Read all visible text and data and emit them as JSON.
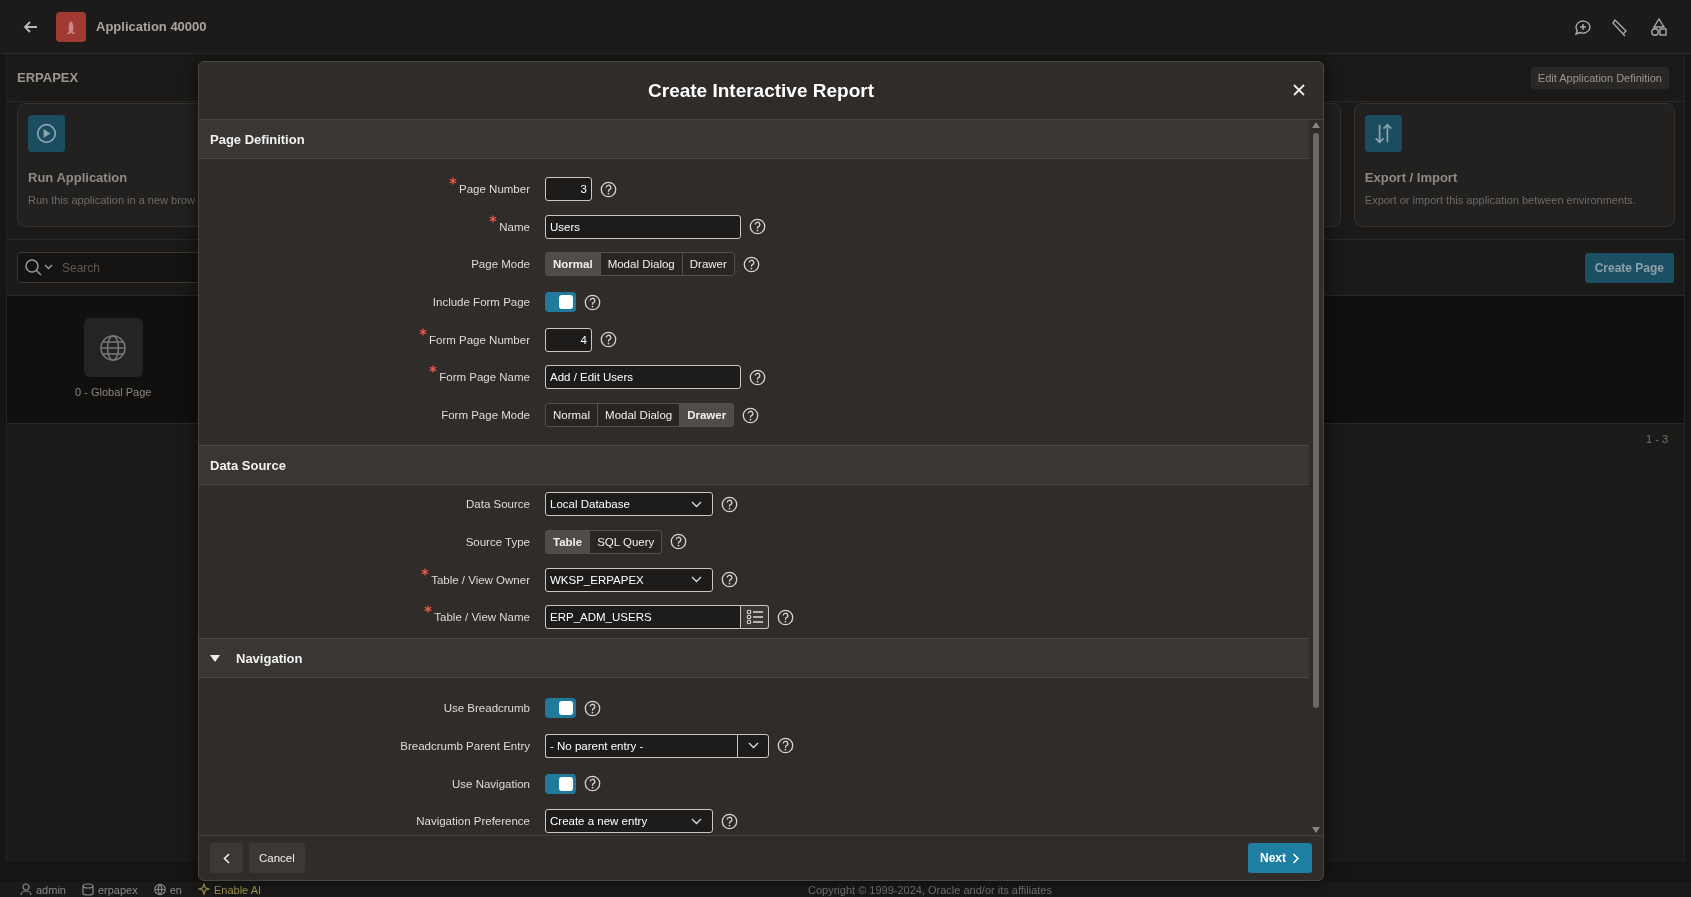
{
  "topbar": {
    "app_title": "Application 40000"
  },
  "workspace": {
    "title": "ERPAPEX",
    "edit_button": "Edit Application Definition",
    "cards": [
      {
        "kind": "run",
        "title": "Run Application",
        "description": "Run this application in a new brow"
      },
      {
        "kind": "transfer",
        "title": "Export / Import",
        "description": "Export or import this application between environments."
      }
    ],
    "search": {
      "placeholder": "Search"
    },
    "create_button": "Create Page",
    "pages": [
      {
        "label": "0 - Global Page"
      }
    ],
    "count": "1 - 3"
  },
  "dialog": {
    "title": "Create Interactive Report",
    "sections": [
      {
        "title": "Page Definition",
        "collapsible": false,
        "fields": [
          {
            "kind": "number",
            "label": "Page Number",
            "required": true,
            "value": "3"
          },
          {
            "kind": "text",
            "label": "Name",
            "required": true,
            "value": "Users"
          },
          {
            "kind": "segmented",
            "label": "Page Mode",
            "required": false,
            "options": [
              {
                "label": "Normal",
                "selected": true
              },
              {
                "label": "Modal Dialog",
                "selected": false
              },
              {
                "label": "Drawer",
                "selected": false
              }
            ]
          },
          {
            "kind": "switch",
            "label": "Include Form Page",
            "required": false,
            "on": true
          },
          {
            "kind": "number",
            "label": "Form Page Number",
            "required": true,
            "value": "4"
          },
          {
            "kind": "text",
            "label": "Form Page Name",
            "required": true,
            "value": "Add / Edit Users"
          },
          {
            "kind": "segmented",
            "label": "Form Page Mode",
            "required": false,
            "options": [
              {
                "label": "Normal",
                "selected": false
              },
              {
                "label": "Modal Dialog",
                "selected": false
              },
              {
                "label": "Drawer",
                "selected": true
              }
            ]
          }
        ]
      },
      {
        "title": "Data Source",
        "collapsible": false,
        "fields": [
          {
            "kind": "select",
            "label": "Data Source",
            "required": false,
            "value": "Local Database"
          },
          {
            "kind": "segmented",
            "label": "Source Type",
            "required": false,
            "options": [
              {
                "label": "Table",
                "selected": true
              },
              {
                "label": "SQL Query",
                "selected": false
              }
            ]
          },
          {
            "kind": "select",
            "label": "Table / View Owner",
            "required": true,
            "value": "WKSP_ERPAPEX"
          },
          {
            "kind": "popup",
            "label": "Table / View Name",
            "required": true,
            "value": "ERP_ADM_USERS"
          }
        ]
      },
      {
        "title": "Navigation",
        "collapsible": true,
        "expanded": true,
        "fields": [
          {
            "kind": "switch",
            "label": "Use Breadcrumb",
            "required": false,
            "on": true
          },
          {
            "kind": "combo",
            "label": "Breadcrumb Parent Entry",
            "required": false,
            "value": "- No parent entry -"
          },
          {
            "kind": "switch",
            "label": "Use Navigation",
            "required": false,
            "on": true
          },
          {
            "kind": "select",
            "label": "Navigation Preference",
            "required": false,
            "value": "Create a new entry"
          }
        ]
      }
    ],
    "cancel_button": "Cancel",
    "next_button": "Next"
  },
  "status_bar": {
    "items": [
      {
        "kind": "user",
        "label": "admin"
      },
      {
        "kind": "schema",
        "label": "erpapex"
      },
      {
        "kind": "language",
        "label": "en"
      },
      {
        "kind": "ai",
        "label": "Enable AI"
      }
    ],
    "copyright": "Copyright © 1999-2024, Oracle and/or its affiliates"
  }
}
